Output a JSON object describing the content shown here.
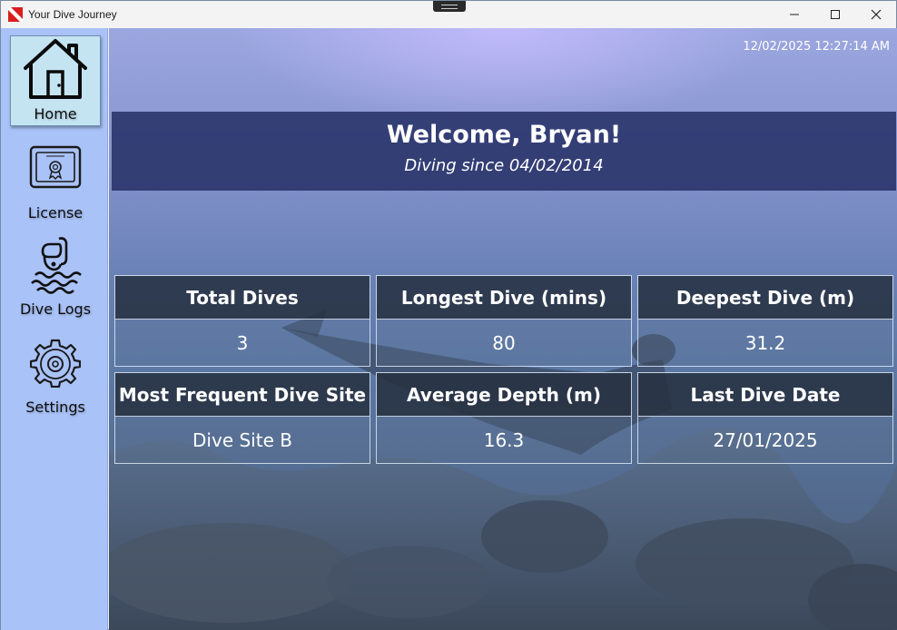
{
  "window": {
    "title": "Your Dive Journey",
    "controls": {
      "minimize": "—",
      "maximize": "☐",
      "close": "✕"
    }
  },
  "sidebar": {
    "items": [
      {
        "label": "Home",
        "icon": "home-icon",
        "active": true
      },
      {
        "label": "License",
        "icon": "license-certificate-icon",
        "active": false
      },
      {
        "label": "Dive Logs",
        "icon": "diver-snorkel-icon",
        "active": false
      },
      {
        "label": "Settings",
        "icon": "gear-icon",
        "active": false
      }
    ]
  },
  "main": {
    "timestamp": "12/02/2025 12:27:14 AM",
    "welcome": {
      "title": "Welcome, Bryan!",
      "subtitle": "Diving since 04/02/2014"
    },
    "stats": [
      {
        "label": "Total Dives",
        "value": "3"
      },
      {
        "label": "Longest Dive (mins)",
        "value": "80"
      },
      {
        "label": "Deepest Dive (m)",
        "value": "31.2"
      },
      {
        "label": "Most Frequent Dive Site",
        "value": "Dive Site B"
      },
      {
        "label": "Average Depth (m)",
        "value": "16.3"
      },
      {
        "label": "Last Dive Date",
        "value": "27/01/2025"
      }
    ]
  },
  "colors": {
    "sidebar_bg": "#a9c2f7",
    "active_nav_bg": "#c4e4f2",
    "banner_bg": "#283269",
    "stat_header_bg": "#232d3c"
  }
}
